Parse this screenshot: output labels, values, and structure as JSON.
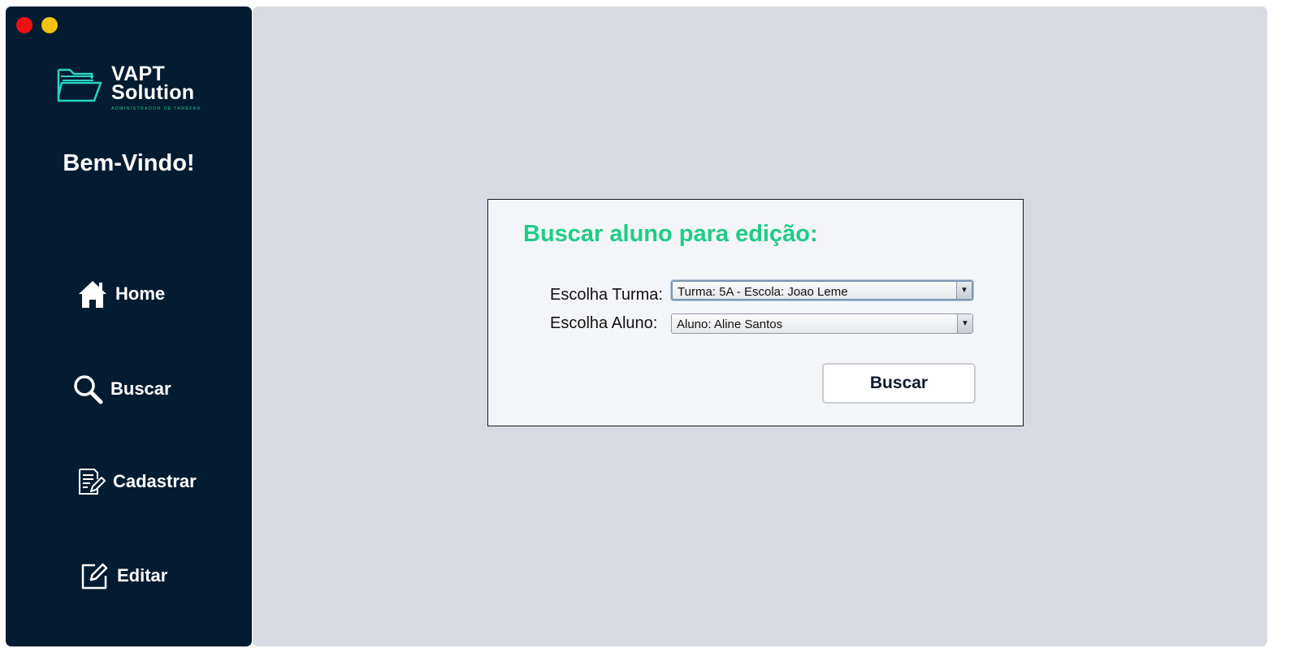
{
  "colors": {
    "sidebar_bg": "#041c32",
    "main_bg": "#d7dae1",
    "accent": "#1fcc88",
    "window_close": "#ee1111",
    "window_minimize": "#f3c20f"
  },
  "sidebar": {
    "logo": {
      "line1": "VAPT",
      "line2": "Solution",
      "tagline": "ADMINISTRADOR DE TAREFAS",
      "icon": "folder-icon"
    },
    "welcome": "Bem-Vindo!",
    "nav": [
      {
        "label": "Home",
        "icon": "home-icon"
      },
      {
        "label": "Buscar",
        "icon": "search-icon"
      },
      {
        "label": "Cadastrar",
        "icon": "register-form-icon"
      },
      {
        "label": "Editar",
        "icon": "edit-icon"
      }
    ]
  },
  "form": {
    "title": "Buscar aluno para edição:",
    "turma_label": "Escolha Turma:",
    "turma_value": "Turma: 5A - Escola: Joao Leme",
    "aluno_label": "Escolha Aluno:",
    "aluno_value": "Aluno: Aline Santos",
    "submit_label": "Buscar"
  }
}
